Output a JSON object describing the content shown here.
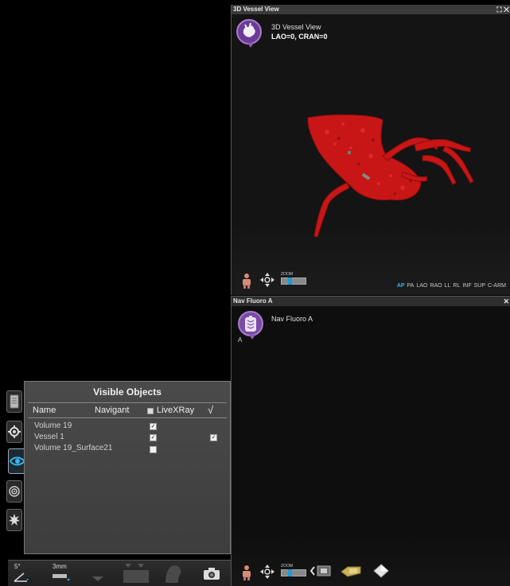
{
  "vessel_view": {
    "panel_title": "3D Vessel View",
    "window_controls": "⛶ ✕",
    "view_name": "3D Vessel View",
    "angle_readout": "LAO=0, CRAN=0",
    "zoom_label": "ZOOM",
    "orientation_buttons": [
      "AP",
      "PA",
      "LAO",
      "RAO",
      "LL",
      "RL",
      "INF",
      "SUP",
      "C-ARM"
    ],
    "active_orientation": "AP"
  },
  "nav_fluoro": {
    "panel_title": "Nav Fluoro A",
    "close_control": "✕",
    "view_name": "Nav Fluoro A",
    "badge_letter": "A",
    "zoom_label": "ZOOM"
  },
  "visible_objects": {
    "title": "Visible Objects",
    "columns": {
      "name": "Name",
      "navigant": "Navigant",
      "livexray": "LiveXRay",
      "check": "√"
    },
    "rows": [
      {
        "name": "Volume 19",
        "navigant": true,
        "livexray": false
      },
      {
        "name": "Vessel 1",
        "navigant": true,
        "livexray": true
      },
      {
        "name": "Volume 19_Surface21",
        "navigant": false,
        "livexray": false
      }
    ]
  },
  "bottom_toolbar": {
    "angle_value": "5°",
    "thickness_value": "3mm"
  },
  "colors": {
    "accent_purple": "#6d3a98",
    "active_view_blue": "#34b4f0",
    "vessel_red": "#d41a1a"
  }
}
